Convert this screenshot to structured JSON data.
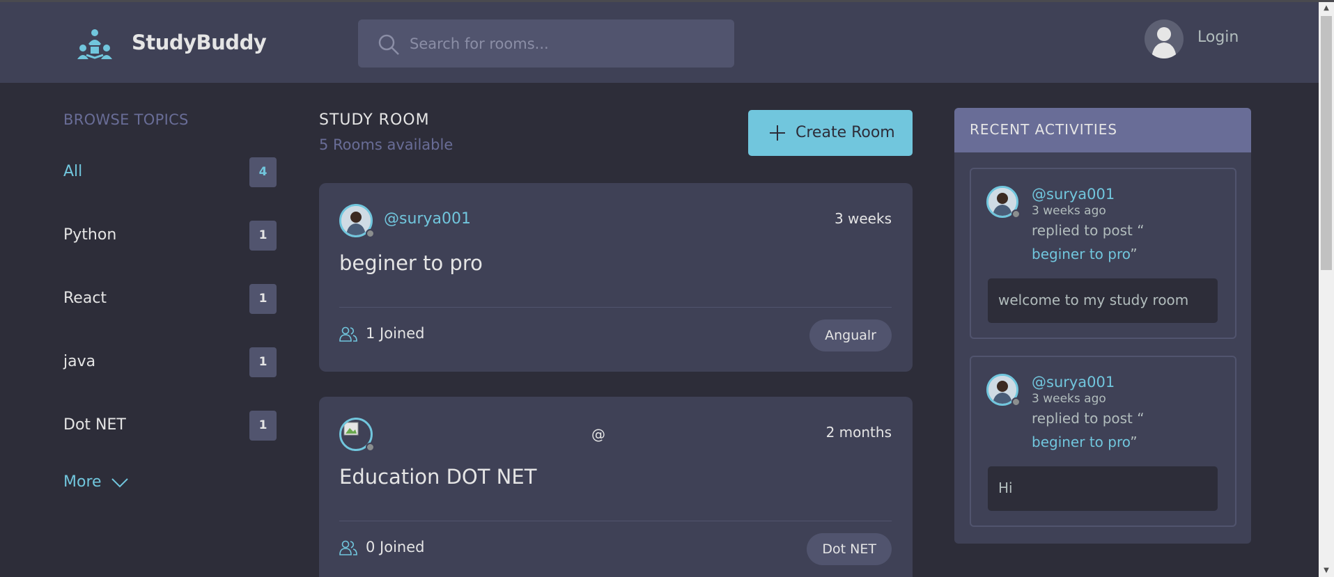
{
  "header": {
    "brand": "StudyBuddy",
    "search_placeholder": "Search for rooms...",
    "login_label": "Login"
  },
  "sidebar": {
    "heading": "BROWSE TOPICS",
    "topics": [
      {
        "name": "All",
        "count": "4",
        "active": true
      },
      {
        "name": "Python",
        "count": "1"
      },
      {
        "name": "React",
        "count": "1"
      },
      {
        "name": "java",
        "count": "1"
      },
      {
        "name": "Dot NET",
        "count": "1"
      }
    ],
    "more_label": "More"
  },
  "main": {
    "title": "STUDY ROOM",
    "rooms_available": "5 Rooms available",
    "create_label": "Create Room",
    "rooms": [
      {
        "host": "@surya001",
        "time": "3 weeks",
        "name": "beginer to pro",
        "joined": "1 Joined",
        "topic": "Angualr"
      },
      {
        "host": "@",
        "time": "2 months",
        "name": "Education DOT NET",
        "joined": "0 Joined",
        "topic": "Dot NET"
      }
    ]
  },
  "activity": {
    "heading": "RECENT ACTIVITIES",
    "items": [
      {
        "user": "@surya001",
        "time": "3 weeks ago",
        "action": "replied to post “",
        "link": "beginer to pro",
        "close_quote": "”",
        "message": "welcome to my study room"
      },
      {
        "user": "@surya001",
        "time": "3 weeks ago",
        "action": "replied to post “",
        "link": "beginer to pro",
        "close_quote": "”",
        "message": "Hi"
      }
    ]
  },
  "colors": {
    "background": "#2d2d39",
    "panel": "#3f4156",
    "accent": "#71c6dd",
    "muted": "#696d97"
  }
}
